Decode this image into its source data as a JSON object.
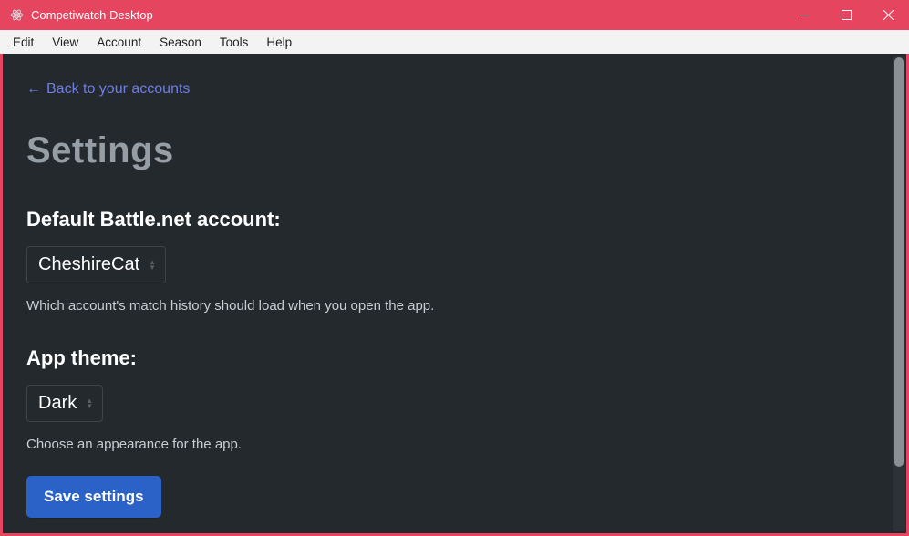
{
  "window": {
    "title": "Competiwatch Desktop"
  },
  "menubar": {
    "items": [
      "Edit",
      "View",
      "Account",
      "Season",
      "Tools",
      "Help"
    ]
  },
  "page": {
    "back_link": "Back to your accounts",
    "title": "Settings",
    "default_account": {
      "label": "Default Battle.net account:",
      "value": "CheshireCat",
      "helper": "Which account's match history should load when you open the app."
    },
    "theme": {
      "label": "App theme:",
      "value": "Dark",
      "helper": "Choose an appearance for the app."
    },
    "save_label": "Save settings"
  },
  "colors": {
    "accent": "#e64560",
    "link": "#6e7ee3",
    "primary_btn": "#2a62c7",
    "bg": "#24292e"
  }
}
